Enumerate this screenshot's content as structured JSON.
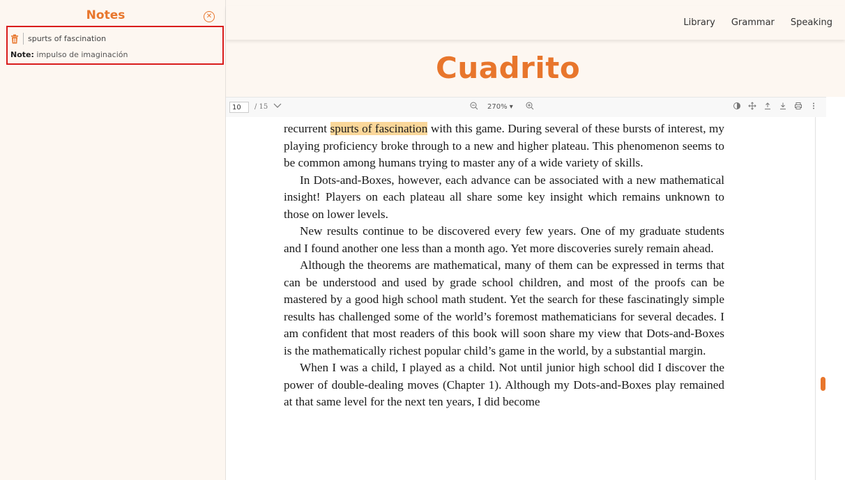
{
  "sidebar": {
    "title": "Notes",
    "close_icon": "close-circle-icon",
    "note": {
      "quote": "spurts of fascination",
      "note_label": "Note:",
      "note_text": "impulso de imaginación",
      "delete_icon": "trash-icon"
    }
  },
  "nav": {
    "items": [
      "Library",
      "Grammar",
      "Speaking"
    ]
  },
  "brand": "Cuadrito",
  "viewer": {
    "page_number": "10",
    "page_total": "/ 15",
    "zoom": "270% ▾",
    "tools": [
      "contrast-icon",
      "move-icon",
      "upload-icon",
      "download-icon",
      "print-icon",
      "more-icon"
    ]
  },
  "document": {
    "p1_before": "recurrent ",
    "p1_highlight": "spurts of fascination",
    "p1_after": " with this game. During several of these bursts of interest, my playing proficiency broke through to a new and higher plateau. This phenomenon seems to be common among humans trying to master any of a wide variety of skills.",
    "p2": "In Dots-and-Boxes, however, each advance can be associated with a new mathematical insight! Players on each plateau all share some key insight which remains unknown to those on lower levels.",
    "p3": "New results continue to be discovered every few years. One of my graduate students and I found another one less than a month ago. Yet more discoveries surely remain ahead.",
    "p4": "Although the theorems are mathematical, many of them can be expressed in terms that can be understood and used by grade school children, and most of the proofs can be mastered by a good high school math student. Yet the search for these fascinatingly simple results has challenged some of the world’s foremost mathematicians for several decades. I am confident that most readers of this book will soon share my view that Dots-and-Boxes is the mathematically richest popular child’s game in the world, by a substantial margin.",
    "p5": "When I was a child, I played as a child. Not until junior high school did I discover the power of double-dealing moves (Chapter 1). Although my Dots-and-Boxes play remained at that same level for the next ten years, I did become"
  },
  "colors": {
    "accent": "#e8762c",
    "highlight": "#fbd79a",
    "selection_border": "#d91c1c"
  }
}
